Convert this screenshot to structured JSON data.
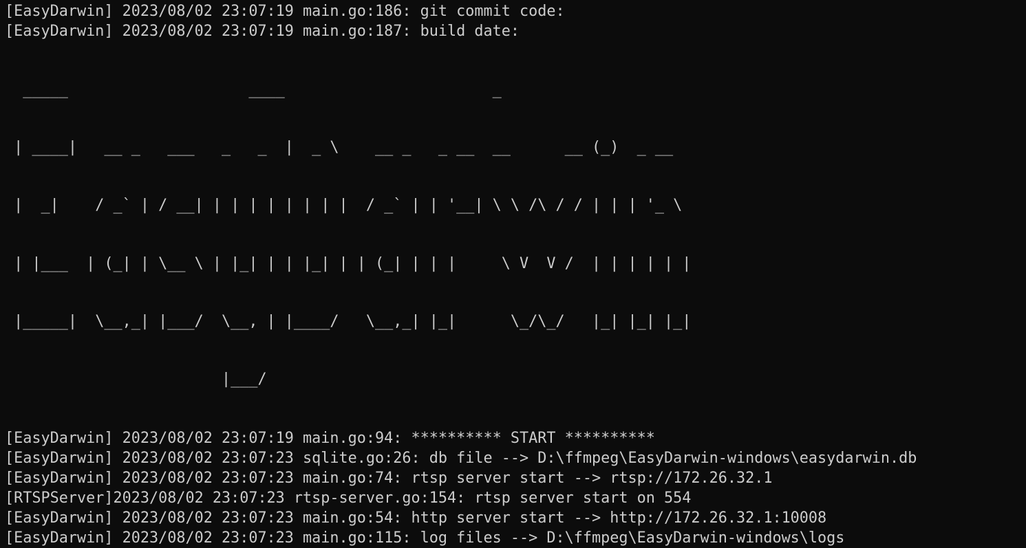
{
  "terminal": {
    "header_lines": [
      "[EasyDarwin] 2023/08/02 23:07:19 main.go:186: git commit code:",
      "[EasyDarwin] 2023/08/02 23:07:19 main.go:187: build date:"
    ],
    "banner_lines": [
      "  _____                    ____                       _",
      " | ____|   __ _   ___   _   _  |  _ \\    __ _   _ __  __      __ (_)  _ __",
      " |  _|    / _` | / __| | | | | | | | |  / _` | | '__| \\ \\ /\\ / / | | | '_ \\",
      " | |___  | (_| | \\__ \\ | |_| | | |_| | | (_| | | |     \\ V  V /  | | | | | |",
      " |_____|  \\__,_| |___/  \\__, | |____/   \\__,_| |_|      \\_/\\_/   |_| |_| |_|",
      "                        |___/"
    ],
    "log_lines": [
      "[EasyDarwin] 2023/08/02 23:07:19 main.go:94: ********** START **********",
      "[EasyDarwin] 2023/08/02 23:07:23 sqlite.go:26: db file --> D:\\ffmpeg\\EasyDarwin-windows\\easydarwin.db",
      "[EasyDarwin] 2023/08/02 23:07:23 main.go:74: rtsp server start --> rtsp://172.26.32.1",
      "[RTSPServer]2023/08/02 23:07:23 rtsp-server.go:154: rtsp server start on 554",
      "[EasyDarwin] 2023/08/02 23:07:23 main.go:54: http server start --> http://172.26.32.1:10008",
      "[EasyDarwin] 2023/08/02 23:07:23 main.go:115: log files --> D:\\ffmpeg\\EasyDarwin-windows\\logs"
    ]
  }
}
